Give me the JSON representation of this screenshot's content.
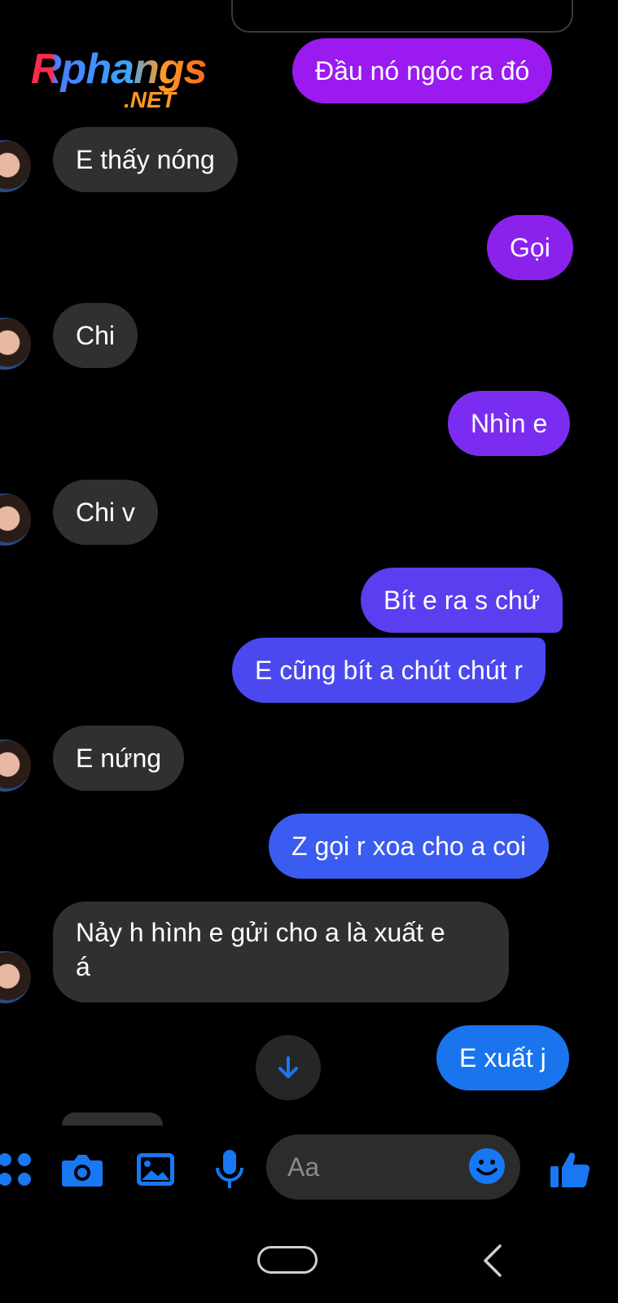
{
  "colors": {
    "background": "#000000",
    "incoming_bubble": "#303030",
    "accent_blue": "#1877f2",
    "composer_bg": "#2c2c2c"
  },
  "watermark": {
    "main": "Rphangs",
    "sub": ".NET"
  },
  "messages": [
    {
      "side": "out",
      "text": "Đầu nó ngóc ra đó",
      "color": "#9a1af0"
    },
    {
      "side": "in",
      "text": "E thấy nóng"
    },
    {
      "side": "out",
      "text": "Gọi",
      "color": "#8a22ec"
    },
    {
      "side": "in",
      "text": "Chi"
    },
    {
      "side": "out",
      "text": "Nhìn e",
      "color": "#7a2df0"
    },
    {
      "side": "in",
      "text": "Chi v"
    },
    {
      "side": "out",
      "text": "Bít e ra s chứ",
      "color": "#5a3ef0"
    },
    {
      "side": "out",
      "text": "E cũng bít a chút chút r",
      "color": "#4a48ee"
    },
    {
      "side": "in",
      "text": "E nứng"
    },
    {
      "side": "out",
      "text": "Z gọi r xoa cho a coi",
      "color": "#3a5cf0"
    },
    {
      "side": "in",
      "line1": "Nảy h hình e gửi cho a là xuất e",
      "line2": "á"
    },
    {
      "side": "out",
      "text": "E xuất j",
      "color": "#1a74ee"
    }
  ],
  "composer": {
    "placeholder": "Aa",
    "icons": [
      "apps-icon",
      "camera-icon",
      "gallery-icon",
      "microphone-icon",
      "emoji-icon",
      "thumbs-up-icon"
    ]
  },
  "navbar": {
    "icons": [
      "home-pill-icon",
      "back-chevron-icon"
    ]
  }
}
